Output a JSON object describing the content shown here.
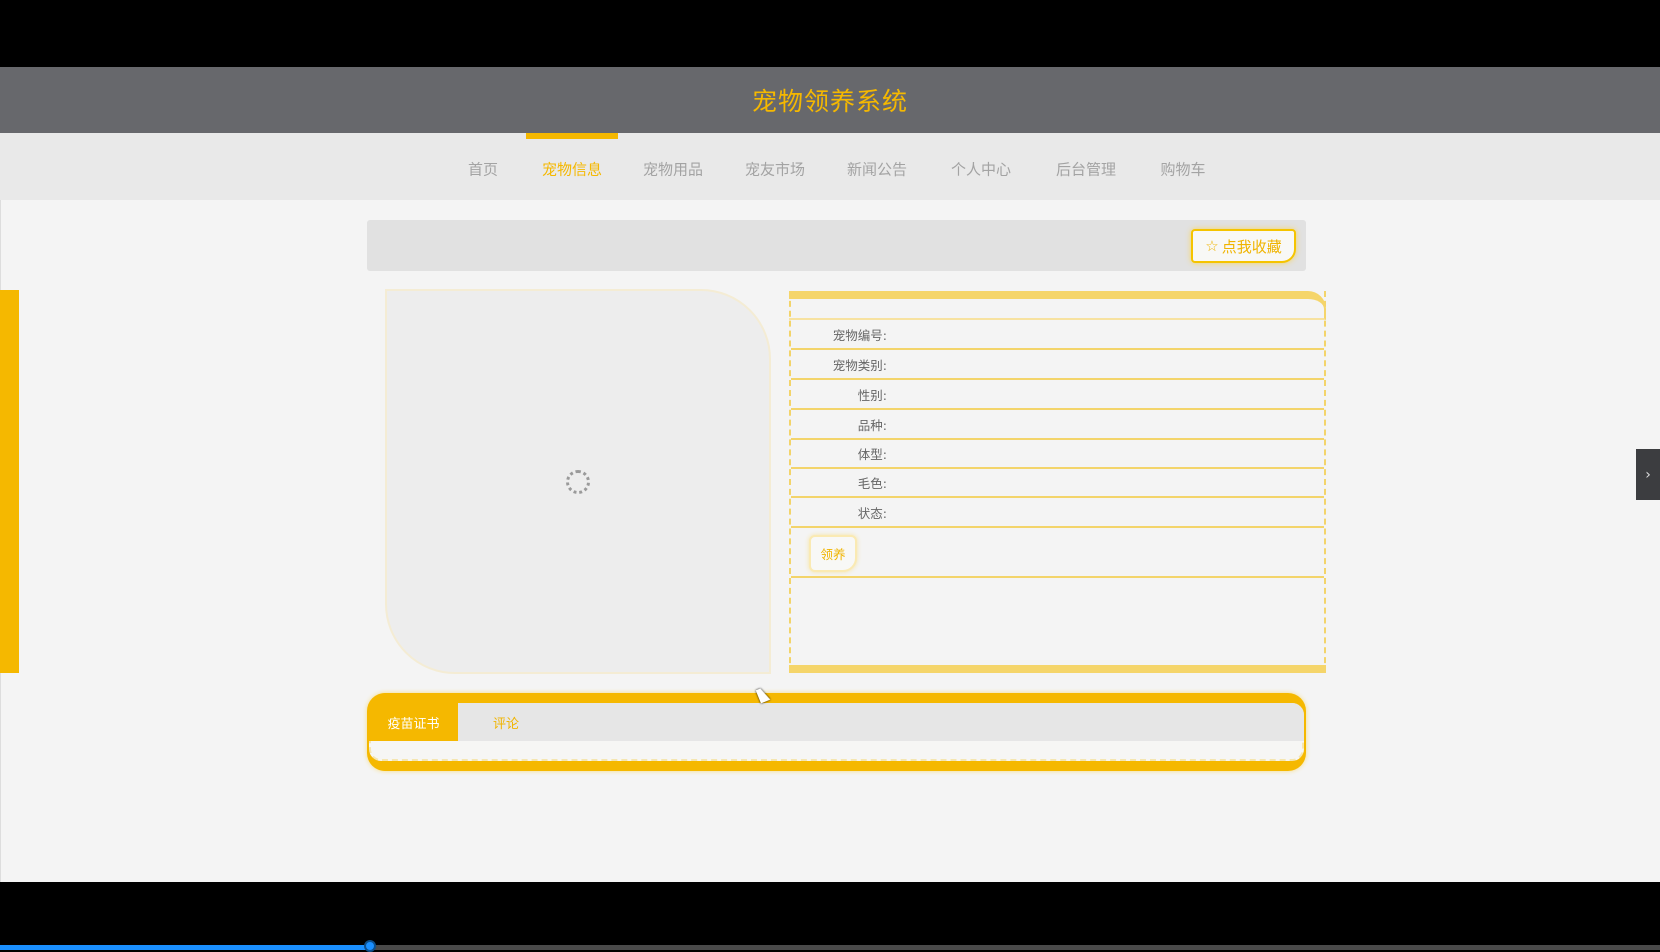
{
  "header": {
    "title": "宠物领养系统"
  },
  "nav": {
    "items": [
      {
        "label": "首页",
        "active": false
      },
      {
        "label": "宠物信息",
        "active": true
      },
      {
        "label": "宠物用品",
        "active": false
      },
      {
        "label": "宠友市场",
        "active": false
      },
      {
        "label": "新闻公告",
        "active": false
      },
      {
        "label": "个人中心",
        "active": false
      },
      {
        "label": "后台管理",
        "active": false
      },
      {
        "label": "购物车",
        "active": false
      }
    ]
  },
  "toolbar": {
    "favorite_label": "点我收藏",
    "favorite_icon": "star-outline-icon"
  },
  "details": {
    "fields": [
      {
        "label": "宠物编号:",
        "value": ""
      },
      {
        "label": "宠物类别:",
        "value": ""
      },
      {
        "label": "性别:",
        "value": ""
      },
      {
        "label": "品种:",
        "value": ""
      },
      {
        "label": "体型:",
        "value": ""
      },
      {
        "label": "毛色:",
        "value": ""
      },
      {
        "label": "状态:",
        "value": ""
      }
    ],
    "adopt_label": "领养"
  },
  "tabs": [
    {
      "label": "疫苗证书",
      "active": true
    },
    {
      "label": "评论",
      "active": false
    }
  ],
  "side_toggle": "›",
  "video_progress": 0.223,
  "colors": {
    "accent": "#f5b800",
    "header_bg": "#67686c"
  }
}
